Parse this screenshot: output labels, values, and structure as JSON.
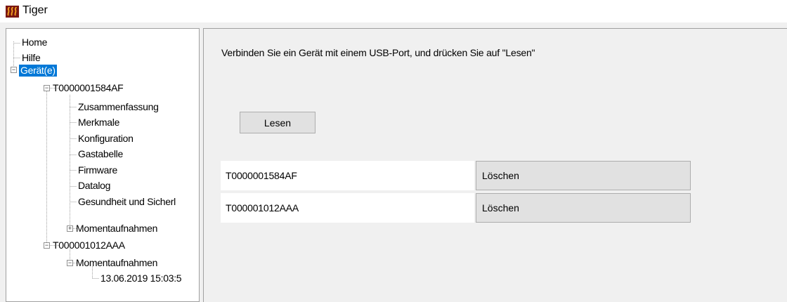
{
  "window": {
    "title": "Tiger",
    "icon": "heater-icon",
    "icon_color": "#7a1712"
  },
  "tree": {
    "home": "Home",
    "help": "Hilfe",
    "devices": "Gerät(e)",
    "selected_color": "#0078d7",
    "device1": {
      "id": "T0000001584AF",
      "children": [
        "Zusammenfassung",
        "Merkmale",
        "Konfiguration",
        "Gastabelle",
        "Firmware",
        "Datalog",
        "Gesundheit und Sicherl",
        "Momentaufnahmen"
      ]
    },
    "device2": {
      "id": "T000001012AAA",
      "snapshots": "Momentaufnahmen",
      "snapshot_entry": "13.06.2019 15:03:5"
    }
  },
  "main": {
    "instruction": "Verbinden Sie ein Gerät mit einem USB-Port, und drücken Sie auf \"Lesen\"",
    "read_button": "Lesen",
    "devices": [
      {
        "serial": "T0000001584AF",
        "delete_label": "Löschen"
      },
      {
        "serial": "T000001012AAA",
        "delete_label": "Löschen"
      }
    ]
  }
}
